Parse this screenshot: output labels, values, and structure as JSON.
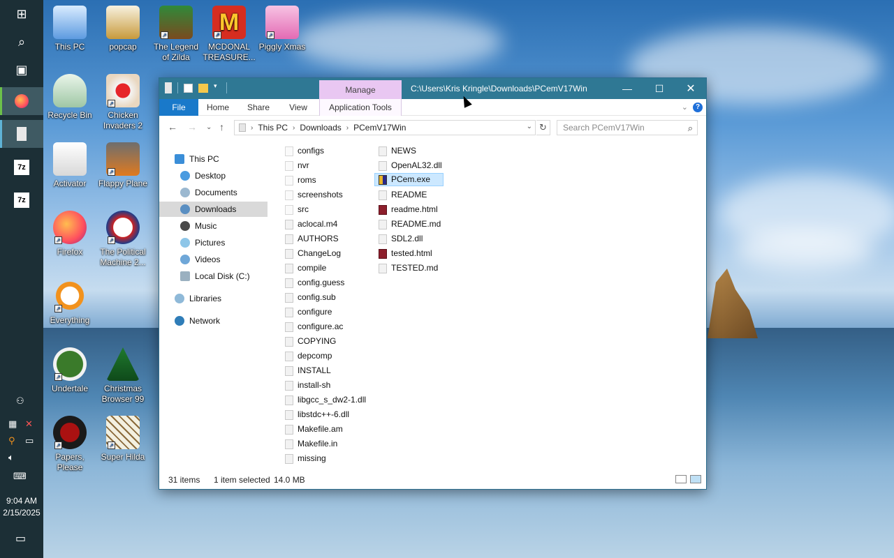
{
  "taskbar": {
    "clock_time": "9:04 AM",
    "clock_date": "2/15/2025",
    "icons": [
      "windows-start-icon",
      "search-icon",
      "task-view-icon",
      "firefox-icon",
      "file-explorer-icon",
      "7zip-icon",
      "7zip-icon",
      "people-icon",
      "network-icon",
      "search-everything-icon",
      "monitor-icon",
      "volume-muted-icon",
      "keyboard-icon",
      "notification-icon"
    ],
    "seven_zip_label": "7z"
  },
  "desktop": {
    "icons": [
      {
        "label": "This PC"
      },
      {
        "label": "popcap"
      },
      {
        "label": "The Legend of Zilda"
      },
      {
        "label": "MCDONAL TREASURE..."
      },
      {
        "label": "Piggly Xmas"
      },
      {
        "label": "Recycle Bin"
      },
      {
        "label": "Chicken Invaders 2"
      },
      {
        "label": "Activator"
      },
      {
        "label": "Flappy Plane"
      },
      {
        "label": "Firefox"
      },
      {
        "label": "The Political Machine 2..."
      },
      {
        "label": "Everything"
      },
      {
        "label": "Undertale"
      },
      {
        "label": "Christmas Browser 99"
      },
      {
        "label": "Papers, Please"
      },
      {
        "label": "Super Hilda"
      }
    ]
  },
  "window": {
    "title_path": "C:\\Users\\Kris Kringle\\Downloads\\PCemV17Win",
    "manage_tab": "Manage",
    "ribbon_tabs": [
      "File",
      "Home",
      "Share",
      "View",
      "Application Tools"
    ],
    "address": {
      "segments": [
        "This PC",
        "Downloads",
        "PCemV17Win"
      ]
    },
    "search_placeholder": "Search PCemV17Win",
    "nav_items": [
      "This PC",
      "Desktop",
      "Documents",
      "Downloads",
      "Music",
      "Pictures",
      "Videos",
      "Local Disk (C:)",
      "Libraries",
      "Network"
    ],
    "selected_nav": "Downloads",
    "files_col1": [
      "configs",
      "nvr",
      "roms",
      "screenshots",
      "src",
      "aclocal.m4",
      "AUTHORS",
      "ChangeLog",
      "compile",
      "config.guess",
      "config.sub",
      "configure",
      "configure.ac",
      "COPYING",
      "depcomp",
      "INSTALL",
      "install-sh",
      "libgcc_s_dw2-1.dll",
      "libstdc++-6.dll",
      "Makefile.am",
      "Makefile.in",
      "missing"
    ],
    "files_col2": [
      "NEWS",
      "OpenAL32.dll",
      "PCem.exe",
      "README",
      "readme.html",
      "README.md",
      "SDL2.dll",
      "tested.html",
      "TESTED.md"
    ],
    "selected_file": "PCem.exe",
    "status": {
      "items": "31 items",
      "selection": "1 item selected",
      "size": "14.0 MB"
    }
  },
  "colors": {
    "titlebar": "#2f7894",
    "manage": "#e9c7f2",
    "file_tab": "#1979ca",
    "selection": "#cce8ff",
    "taskbar": "#1c2f36"
  }
}
